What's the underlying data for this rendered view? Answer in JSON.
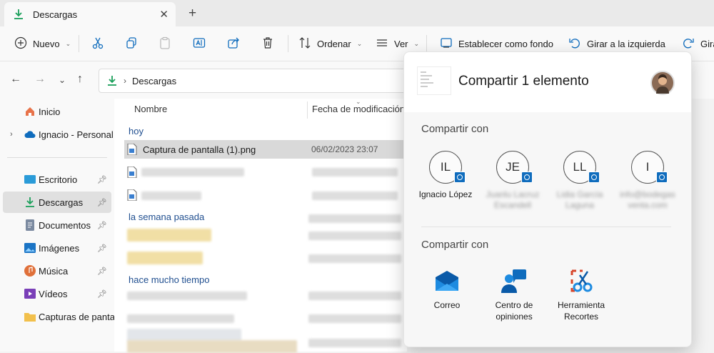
{
  "tab": {
    "title": "Descargas"
  },
  "toolbar": {
    "new_label": "Nuevo",
    "sort_label": "Ordenar",
    "view_label": "Ver",
    "set_background_label": "Establecer como fondo",
    "rotate_left_label": "Girar a la izquierda",
    "rotate_right_label": "Girar"
  },
  "address": {
    "path": "Descargas"
  },
  "sidebar": {
    "items": [
      {
        "label": "Inicio"
      },
      {
        "label": "Ignacio - Personal"
      },
      {
        "label": "Escritorio"
      },
      {
        "label": "Descargas"
      },
      {
        "label": "Documentos"
      },
      {
        "label": "Imágenes"
      },
      {
        "label": "Música"
      },
      {
        "label": "Vídeos"
      },
      {
        "label": "Capturas de pantall"
      }
    ]
  },
  "filelist": {
    "col_name": "Nombre",
    "col_date": "Fecha de modificación",
    "groups": [
      "hoy",
      "la semana pasada",
      "hace mucho tiempo"
    ],
    "selected_file": {
      "name": "Captura de pantalla (1).png",
      "date": "06/02/2023 23:07"
    }
  },
  "share": {
    "title": "Compartir 1 elemento",
    "section_contacts": "Compartir con",
    "section_apps": "Compartir con",
    "contacts": [
      {
        "initials": "IL",
        "name": "Ignacio López"
      },
      {
        "initials": "JE",
        "name": "Juanlu Lacruz Escandell"
      },
      {
        "initials": "LL",
        "name": "Lidia García Laguna"
      },
      {
        "initials": "I",
        "name": "info@bodegas venta.com"
      }
    ],
    "apps": [
      {
        "label": "Correo"
      },
      {
        "label": "Centro de opiniones"
      },
      {
        "label": "Herramienta Recortes"
      }
    ]
  },
  "colors": {
    "accent": "#0f6cbd",
    "download_green": "#1a9f5a"
  }
}
